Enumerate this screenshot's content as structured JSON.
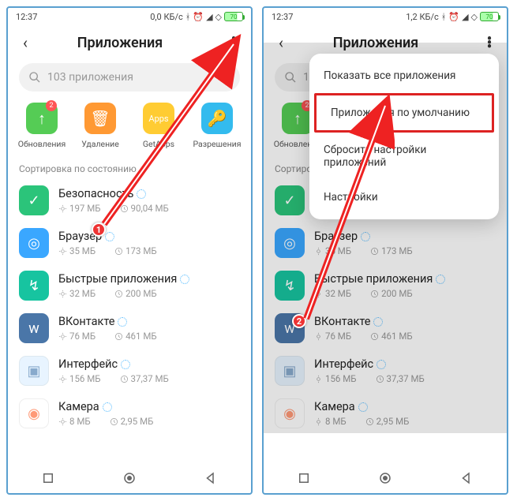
{
  "status": {
    "time": "12:37",
    "speed1": "0,0 КБ/с",
    "speed2": "1,2 КБ/с",
    "battery": "70"
  },
  "header": {
    "title": "Приложения"
  },
  "search": {
    "placeholder": "103 приложения"
  },
  "actions": [
    {
      "label": "Обновления",
      "color": "#55cc55",
      "symbol": "↑",
      "badge": "2"
    },
    {
      "label": "Удаление",
      "color": "#ff9933",
      "symbol": "🗑"
    },
    {
      "label": "GetApp",
      "color": "#ffcc33",
      "symbol": "Apps",
      "shortLabel": "GetApps"
    },
    {
      "label": "Разрешения",
      "color": "#33bbee",
      "symbol": "🔑"
    }
  ],
  "sort": {
    "label": "Сортировка по состоянию"
  },
  "apps": [
    {
      "name": "Безопасность",
      "ram": "197 МБ",
      "time": "90,04 МБ",
      "bg": "#2bc47a",
      "symbol": "✓"
    },
    {
      "name": "Браузер",
      "ram": "35 МБ",
      "time": "173 МБ",
      "bg": "#3aa7ff",
      "symbol": "◎"
    },
    {
      "name": "Быстрые приложения",
      "ram": "32 МБ",
      "time": "200 МБ",
      "bg": "#17c4a0",
      "symbol": "↯"
    },
    {
      "name": "ВКонтакте",
      "ram": "76 МБ",
      "time": "461 МБ",
      "bg": "#4a76a8",
      "symbol": "w"
    },
    {
      "name": "Интерфейс",
      "ram": "156 МБ",
      "time": "37,37 МБ",
      "bg": "#e8f4ff",
      "symbol": "▣",
      "fg": "#88aacc"
    },
    {
      "name": "Камера",
      "ram": "8 МБ",
      "time": "2,95 МБ",
      "bg": "#ffffff",
      "symbol": "◉",
      "fg": "#ff9977"
    }
  ],
  "menu": [
    "Показать все приложения",
    "Приложения по умолчанию",
    "Сбросить настройки приложений",
    "Настройки"
  ],
  "markers": {
    "one": "1",
    "two": "2"
  }
}
